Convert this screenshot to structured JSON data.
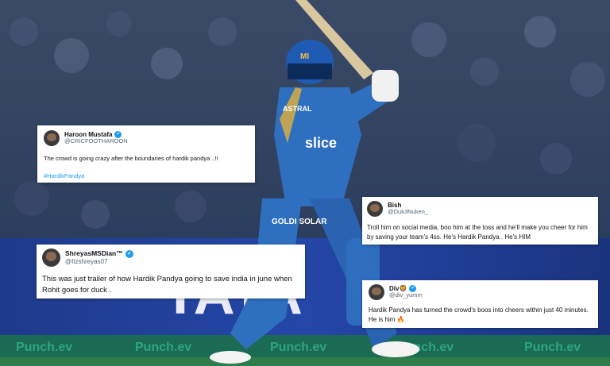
{
  "scene": {
    "jersey_sponsor": "slice",
    "helmet_brand": "MI",
    "glove_logo": "GOLDI SOLAR",
    "shirt_logo": "ASTRAL",
    "board_texts": [
      "Punch.ev",
      "Punch.ev",
      "Punch.ev",
      "Punch.ev",
      "Punch.ev"
    ],
    "board_brand": "TATA",
    "colors": {
      "jersey": "#2f6fc0",
      "crowd": "#2a3a5c",
      "board": "#1f3f9a"
    }
  },
  "tweets": [
    {
      "name": "Haroon Mustafa",
      "verified": "✓",
      "handle": "@CRICFOOTHAROON",
      "text": "The crowd is going crazy after the boundaries of hardik pandya ..!!",
      "hashtag": "#HardikPandya"
    },
    {
      "name": "Bish",
      "handle": "@Duk3Nuken_",
      "text": "Troll him on social media, boo him at the toss and he'll make you cheer for him by saving your team's 4ss. He's Hardik Pandya . He's HIM"
    },
    {
      "name": "ShreyasMSDian™",
      "verified": "✓",
      "handle": "@Itzshreyas07",
      "text": "This was just trailer of how Hardik Pandya going to save india in june when Rohit goes for duck ."
    },
    {
      "name": "Div🦁",
      "verified": "✓",
      "handle": "@div_yumm",
      "text": "Hardik Pandya has turned the crowd's boos into cheers within just 40 minutes. He is him",
      "emoji": "🔥"
    }
  ]
}
